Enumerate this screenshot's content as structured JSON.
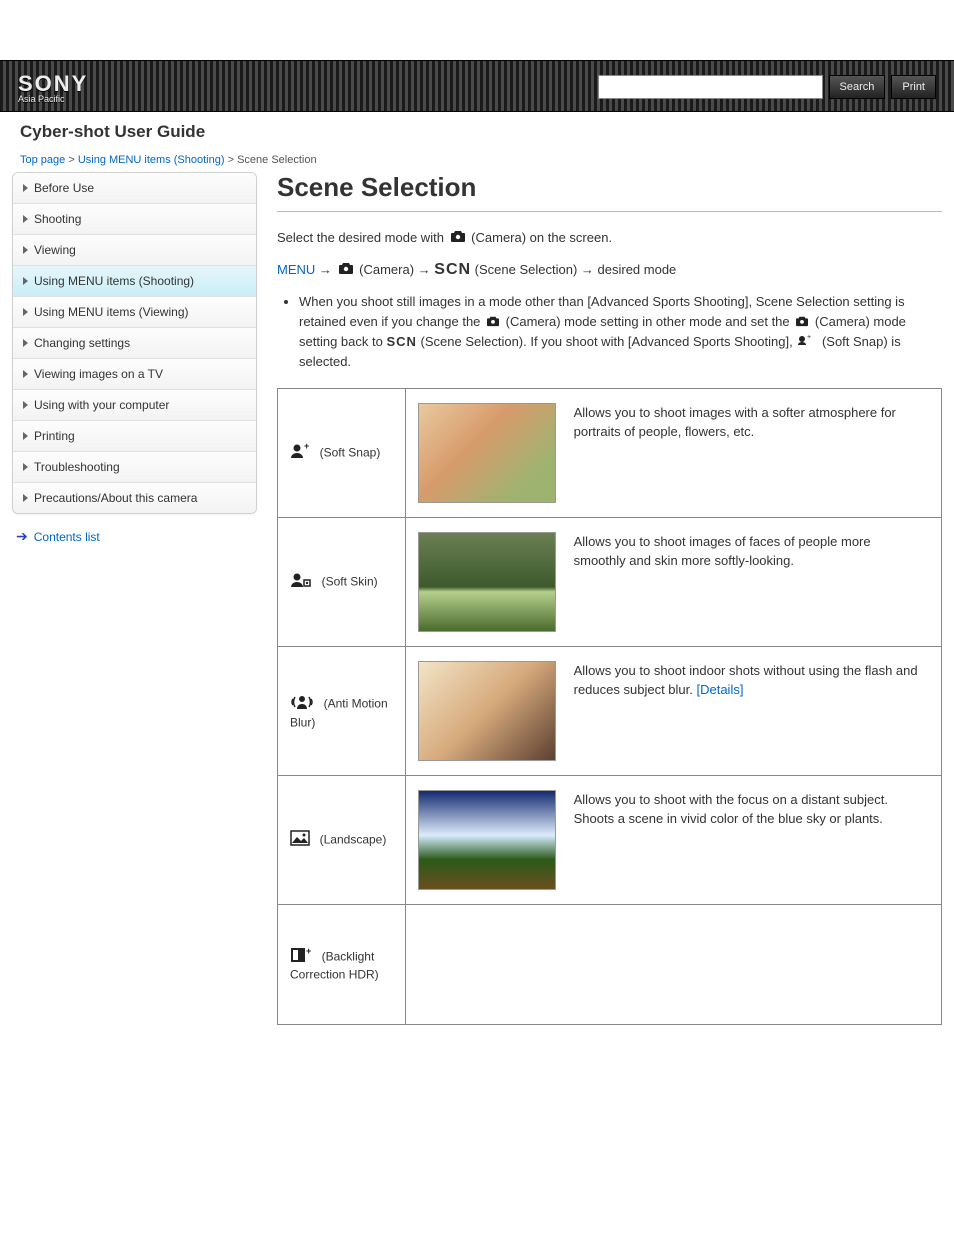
{
  "brand": {
    "name": "SONY",
    "region": "Asia Pacific"
  },
  "header": {
    "search_placeholder": "",
    "search_btn": "Search",
    "print_btn": "Print"
  },
  "product_line": "Cyber-shot User Guide",
  "breadcrumb": {
    "top": "Top page",
    "cat": "Using MENU items (Shooting)",
    "current": "Scene Selection"
  },
  "sidebar": {
    "items": [
      {
        "label": "Before Use"
      },
      {
        "label": "Shooting"
      },
      {
        "label": "Viewing"
      },
      {
        "label": "Using MENU items (Shooting)"
      },
      {
        "label": "Using MENU items (Viewing)"
      },
      {
        "label": "Changing settings"
      },
      {
        "label": "Viewing images on a TV"
      },
      {
        "label": "Using with your computer"
      },
      {
        "label": "Printing"
      },
      {
        "label": "Troubleshooting"
      },
      {
        "label": "Precautions/About this camera"
      }
    ],
    "active_index": 3,
    "contents_link": "Contents list"
  },
  "page": {
    "title": "Scene Selection",
    "intro_before_icon": "Select the desired mode with ",
    "intro_after_icon": " (Camera) on the screen.",
    "menu_path_prefix": "MENU",
    "menu_path_arrow": " → ",
    "menu_path_camera": " (Camera)",
    "menu_path_scn": " (Scene Selection)",
    "menu_path_suffix": " → desired mode",
    "note_text": "When you shoot still images in a mode other than [Advanced Sports Shooting], Scene Selection setting is retained even if you change the ",
    "note_camera": " (Camera) mode setting in other mode and set the ",
    "note_camera2": " (Camera) mode setting back to ",
    "note_scn": " (Scene Selection). If you shoot with [Advanced Sports Shooting], ",
    "note_soft_snap": " (Soft Snap) is selected.",
    "rows": [
      {
        "mode_name": "(Soft Snap)",
        "img_class": "img-soft-snap",
        "desc": "Allows you to shoot images with a softer atmosphere for portraits of people, flowers, etc."
      },
      {
        "mode_name": "(Soft Skin)",
        "img_class": "img-soft-skin",
        "desc": "Allows you to shoot images of faces of people more smoothly and skin more softly-looking."
      },
      {
        "mode_name": "(Anti Motion Blur)",
        "img_class": "img-anti-blur",
        "desc": "Allows you to shoot indoor shots without using the flash and reduces subject blur.",
        "details_link": "[Details]"
      },
      {
        "mode_name": "(Landscape)",
        "img_class": "img-landscape",
        "desc": "Allows you to shoot with the focus on a distant subject. Shoots a scene in vivid color of the blue sky or plants."
      },
      {
        "mode_name": "(Backlight Correction HDR)",
        "img_class": "",
        "desc": ""
      }
    ]
  }
}
